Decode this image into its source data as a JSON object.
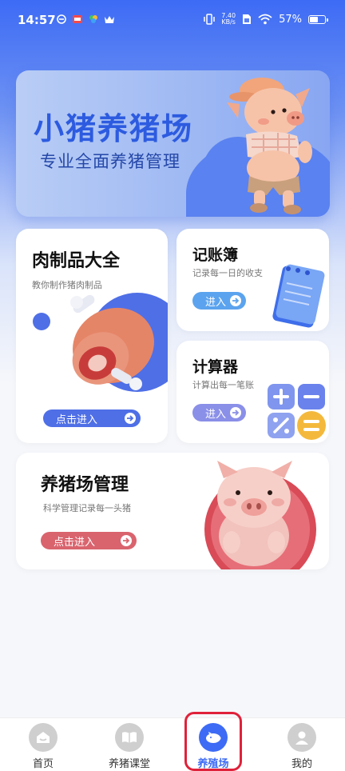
{
  "status_bar": {
    "time": "14:57",
    "net_speed_value": "7.40",
    "net_speed_unit": "KB/s",
    "battery": "57%",
    "battery_level": 0.57,
    "notification_icons": [
      "sync-icon",
      "app-notification-icon",
      "color-app-icon",
      "crown-icon"
    ],
    "right_icons": [
      "vibrate-icon",
      "sim-icon",
      "wifi-icon",
      "battery-icon"
    ]
  },
  "banner": {
    "title": "小猪养猪场",
    "subtitle": "专业全面养猪管理"
  },
  "cards": {
    "meat": {
      "title": "肉制品大全",
      "desc": "教你制作猪肉制品",
      "button": "点击进入",
      "button_color": "#4F6FE6"
    },
    "account": {
      "title": "记账簿",
      "desc": "记录每一日的收支",
      "button": "进入",
      "button_color": "#5BA3EE"
    },
    "calculator": {
      "title": "计算器",
      "desc": "计算出每一笔账",
      "button": "进入",
      "button_color": "#8A8FE8"
    },
    "farm": {
      "title": "养猪场管理",
      "desc": "科学管理记录每一头猪",
      "button": "点击进入",
      "button_color": "#D9646E"
    }
  },
  "bottom_nav": {
    "items": [
      {
        "label": "首页",
        "icon": "home-icon",
        "active": false
      },
      {
        "label": "养猪课堂",
        "icon": "book-icon",
        "active": false
      },
      {
        "label": "养殖场",
        "icon": "pig-icon",
        "active": true
      },
      {
        "label": "我的",
        "icon": "user-icon",
        "active": false
      }
    ],
    "active_color": "#3D6BF5",
    "highlight_color": "#E0213A"
  }
}
